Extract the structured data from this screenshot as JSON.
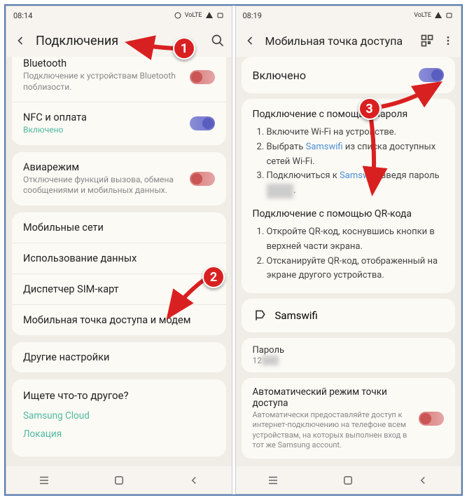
{
  "left": {
    "time": "08:14",
    "title": "Подключения",
    "items": [
      {
        "title": "Bluetooth",
        "sub": "Подключение к устройствам Bluetooth поблизости.",
        "toggle": "off",
        "partial": true
      },
      {
        "title": "NFC и оплата",
        "sub": "Включено",
        "subOn": true,
        "toggle": "on"
      }
    ],
    "items2": [
      {
        "title": "Авиарежим",
        "sub": "Отключение функций вызова, обмена сообщениями и мобильных данных.",
        "toggle": "off"
      }
    ],
    "items3": [
      {
        "title": "Мобильные сети"
      },
      {
        "title": "Использование данных"
      },
      {
        "title": "Диспетчер SIM-карт"
      },
      {
        "title": "Мобильная точка доступа и модем"
      }
    ],
    "items4": [
      {
        "title": "Другие настройки"
      }
    ],
    "search": {
      "title": "Ищете что-то другое?",
      "links": [
        "Samsung Cloud",
        "Локация"
      ]
    }
  },
  "right": {
    "time": "08:19",
    "title": "Мобильная точка доступа",
    "enabled": "Включено",
    "pwSection": {
      "title": "Подключение с помощью пароля",
      "steps": [
        "Включите Wi-Fi на устройстве.",
        "Выбрать Samswifi из списка доступных сетей Wi-Fi.",
        "Подключиться к Samswifi, введя пароль ██████."
      ],
      "linkWord": "Samswifi"
    },
    "qrSection": {
      "title": "Подключение с помощью QR-кода",
      "steps": [
        "Откройте QR-код, коснувшись кнопки в верхней части экрана.",
        "Отсканируйте QR-код, отображенный на экране другого устройства."
      ]
    },
    "ssid": "Samswifi",
    "passLabel": "Пароль",
    "passVal": "12████",
    "auto": {
      "title": "Автоматический режим точки доступа",
      "desc": "Автоматически предоставляйте доступ к интернет-подключению на телефоне всем устройствам, на которых выполнен вход в тот же Samsung account."
    }
  },
  "badges": {
    "b1": "1",
    "b2": "2",
    "b3": "3"
  }
}
